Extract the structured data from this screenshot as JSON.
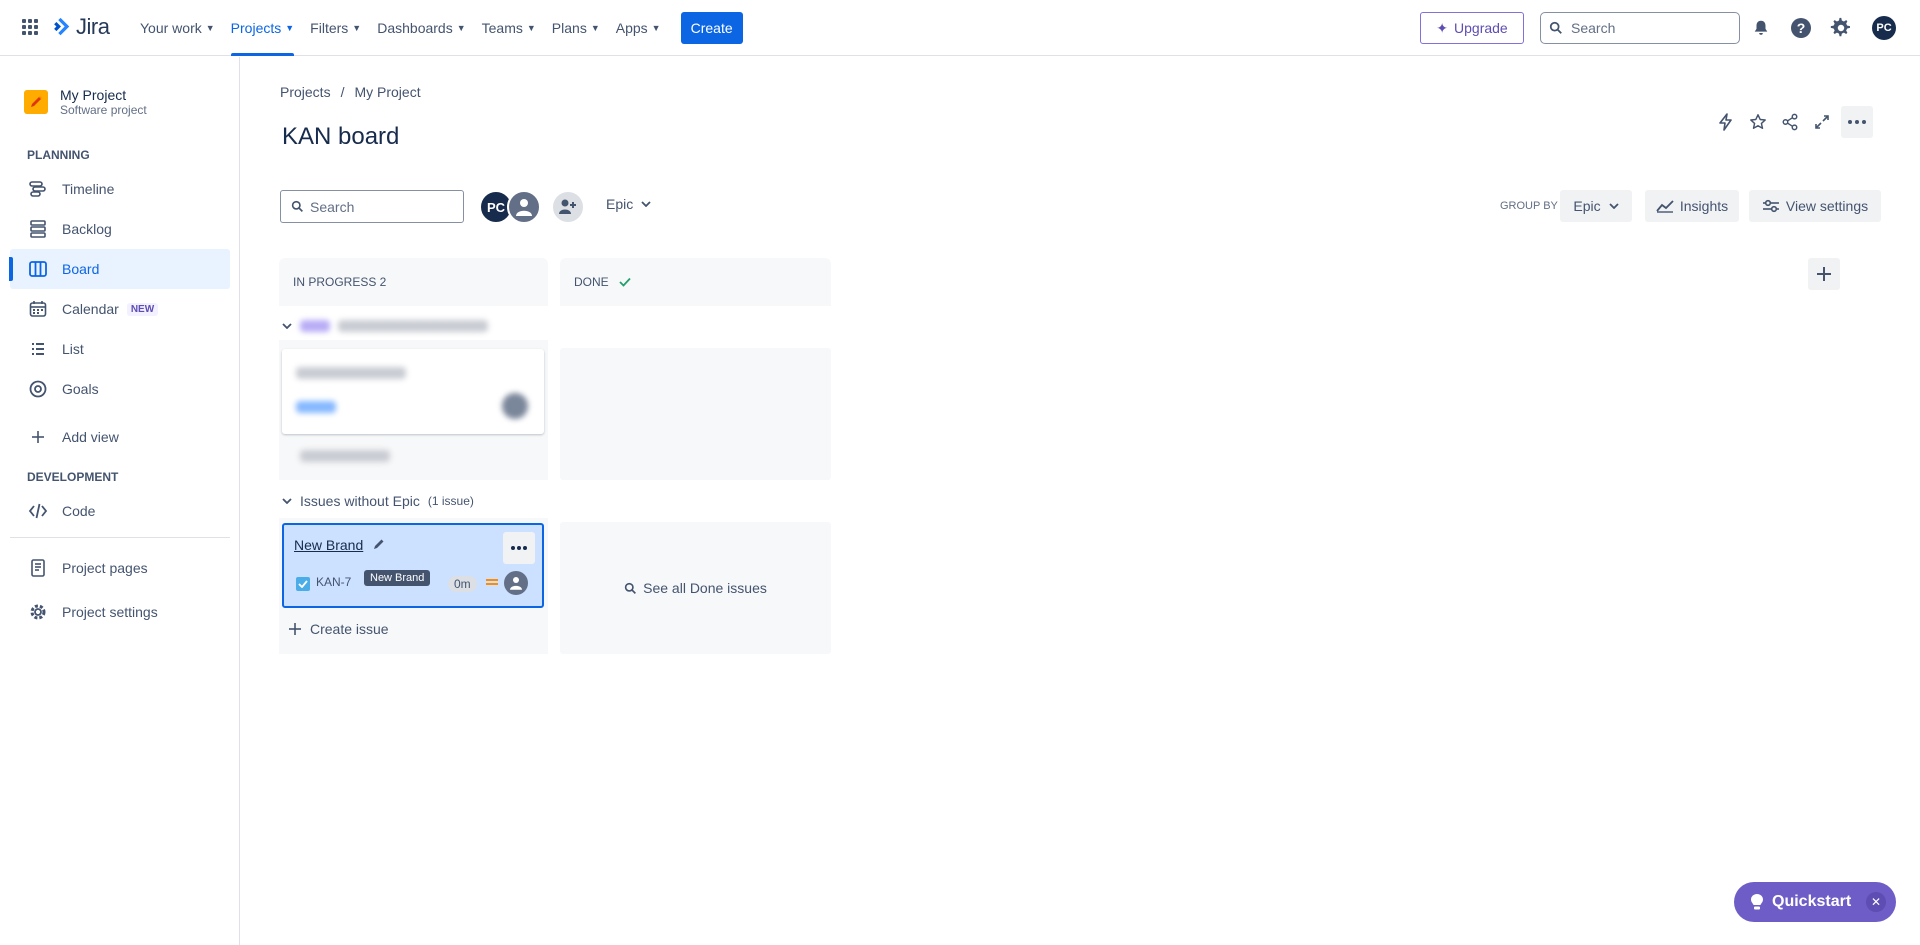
{
  "topbar": {
    "logo_text": "Jira",
    "nav": [
      {
        "label": "Your work"
      },
      {
        "label": "Projects"
      },
      {
        "label": "Filters"
      },
      {
        "label": "Dashboards"
      },
      {
        "label": "Teams"
      },
      {
        "label": "Plans"
      },
      {
        "label": "Apps"
      }
    ],
    "create_label": "Create",
    "upgrade_label": "Upgrade",
    "search_placeholder": "Search",
    "user_initials": "PC",
    "active_nav": "Projects",
    "accent_color": "#0c66e4"
  },
  "sidebar": {
    "project_name": "My Project",
    "project_type": "Software project",
    "planning_label": "PLANNING",
    "development_label": "DEVELOPMENT",
    "items": [
      {
        "label": "Timeline",
        "icon": "timeline-icon"
      },
      {
        "label": "Backlog",
        "icon": "backlog-icon"
      },
      {
        "label": "Board",
        "icon": "board-icon"
      },
      {
        "label": "Calendar",
        "icon": "calendar-icon",
        "badge": "NEW"
      },
      {
        "label": "List",
        "icon": "list-icon"
      },
      {
        "label": "Goals",
        "icon": "goals-icon"
      },
      {
        "label": "Add view",
        "icon": "plus-icon"
      },
      {
        "label": "Code",
        "icon": "code-icon"
      },
      {
        "label": "Project pages",
        "icon": "pages-icon"
      },
      {
        "label": "Project settings",
        "icon": "gear-icon"
      }
    ],
    "active_item": "Board"
  },
  "main": {
    "breadcrumb": [
      "Projects",
      "My Project"
    ],
    "breadcrumb_sep": "/",
    "title": "KAN board",
    "search_placeholder": "Search",
    "avatar_initials": "PC",
    "epic_filter_label": "Epic",
    "group_by_label": "GROUP BY",
    "group_by_value": "Epic",
    "insights_label": "Insights",
    "view_settings_label": "View settings"
  },
  "board": {
    "columns": [
      {
        "title": "IN PROGRESS 2"
      },
      {
        "title": "DONE"
      }
    ],
    "swimlane2": {
      "label": "Issues without Epic",
      "count": "(1 issue)"
    },
    "card": {
      "title": "New Brand",
      "key": "KAN-7",
      "tooltip": "New Brand",
      "estimate": "0m",
      "priority": "medium",
      "selected": true
    },
    "create_issue_label": "Create issue",
    "see_done_label": "See all Done issues"
  },
  "quickstart_label": "Quickstart"
}
